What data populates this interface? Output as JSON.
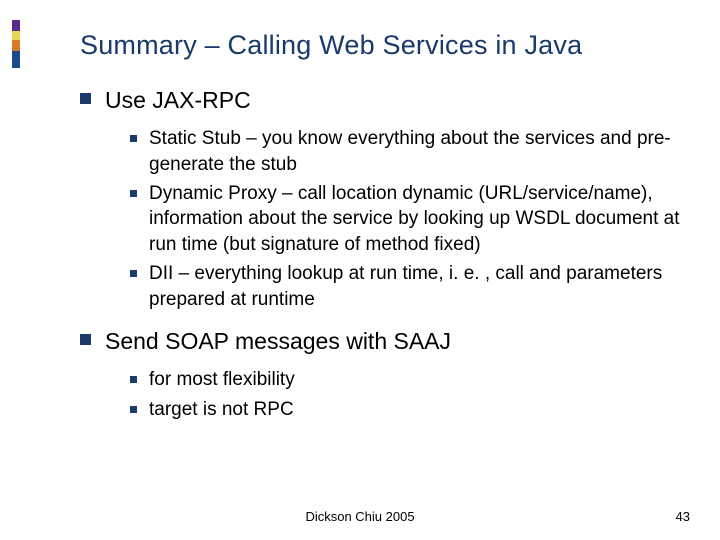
{
  "title": "Summary – Calling Web Services in Java",
  "items": [
    {
      "label": "Use JAX-RPC",
      "sub": [
        "Static Stub – you know everything about the services and pre-generate the stub",
        "Dynamic Proxy – call location dynamic (URL/service/name), information about the service by looking up WSDL document at run time (but signature of method fixed)",
        "DII – everything lookup at run time, i. e. , call and parameters prepared at runtime"
      ]
    },
    {
      "label": "Send SOAP messages with SAAJ",
      "sub": [
        "for most flexibility",
        "target is not RPC"
      ]
    }
  ],
  "footer": {
    "author": "Dickson Chiu 2005",
    "page": "43"
  }
}
